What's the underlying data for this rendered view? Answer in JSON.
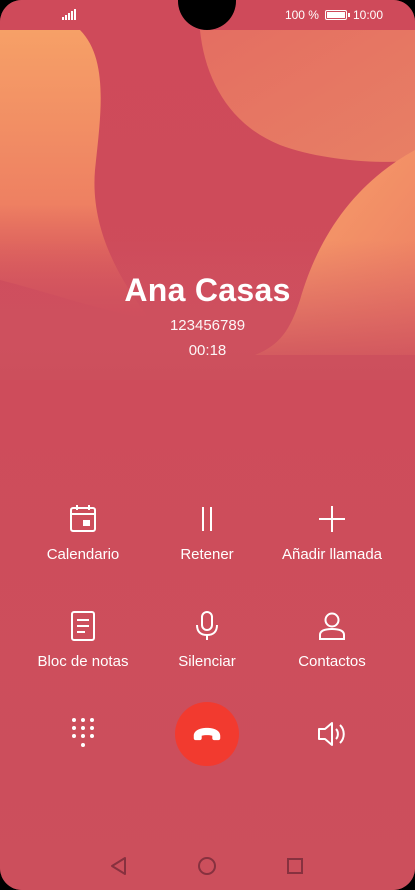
{
  "status_bar": {
    "battery_text": "100 %",
    "time": "10:00"
  },
  "caller": {
    "name": "Ana Casas",
    "number": "123456789",
    "duration": "00:18"
  },
  "actions": {
    "calendar": {
      "label": "Calendario",
      "icon": "calendar-icon"
    },
    "hold": {
      "label": "Retener",
      "icon": "pause-icon"
    },
    "add_call": {
      "label": "Añadir llamada",
      "icon": "plus-icon"
    },
    "notes": {
      "label": "Bloc de notas",
      "icon": "notepad-icon"
    },
    "mute": {
      "label": "Silenciar",
      "icon": "microphone-icon"
    },
    "contacts": {
      "label": "Contactos",
      "icon": "person-icon"
    }
  },
  "bottom": {
    "keypad_icon": "dialpad-icon",
    "end_call_icon": "hang-up-icon",
    "speaker_icon": "speaker-icon"
  },
  "nav": {
    "back_icon": "back-triangle-icon",
    "home_icon": "home-circle-icon",
    "recents_icon": "recents-square-icon"
  },
  "colors": {
    "background": "#cc4f5c",
    "end_call": "#f23a2f",
    "accent_orange": "#f59a6a"
  }
}
